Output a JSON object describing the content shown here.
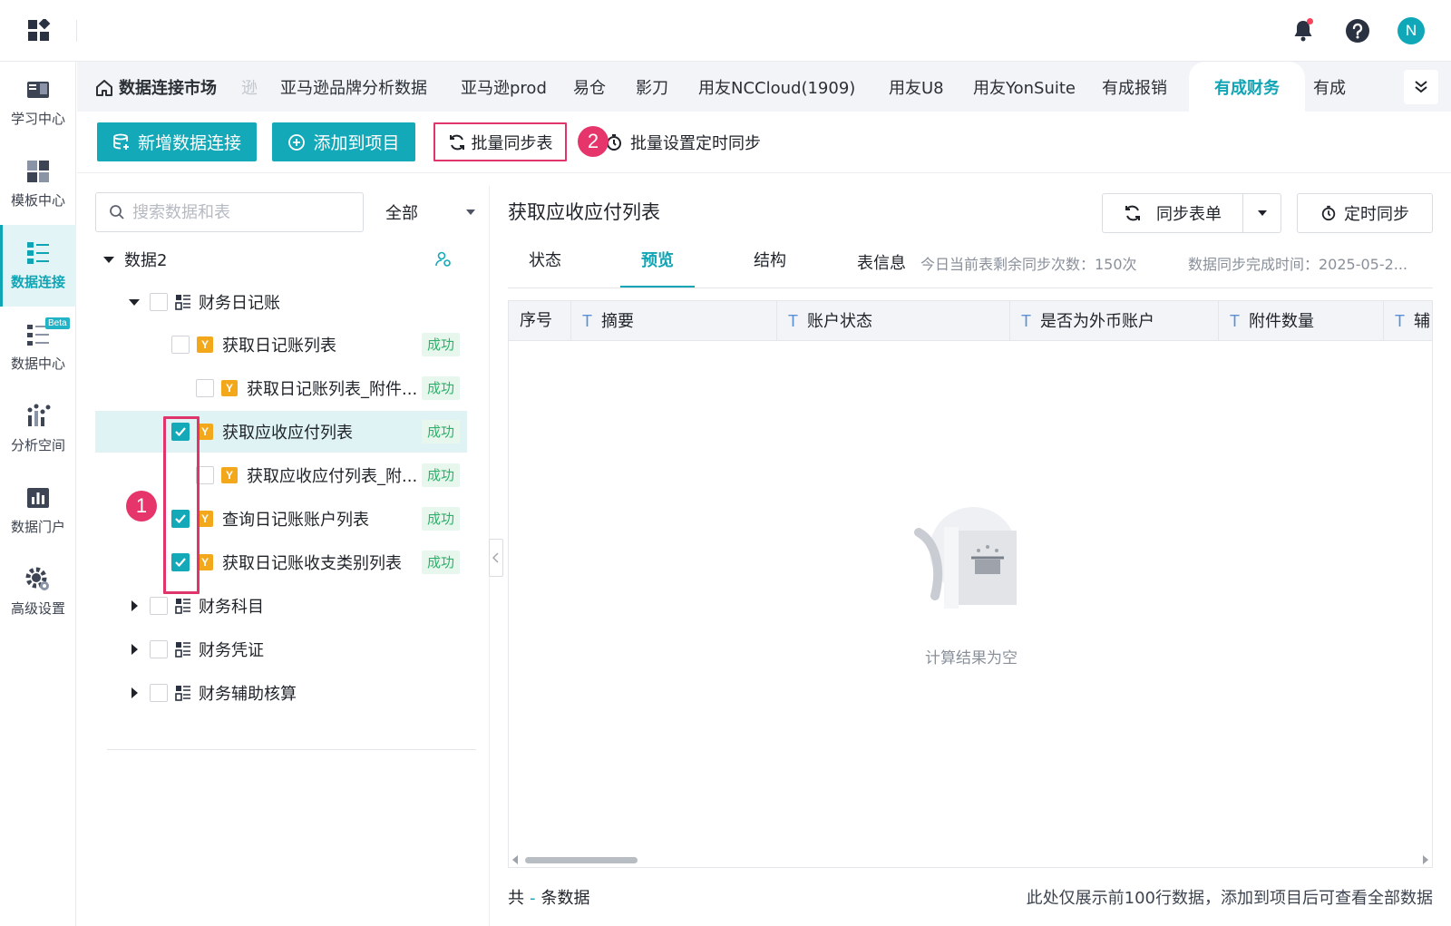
{
  "nav": {
    "items": [
      {
        "label": "学习中心",
        "icon": "study-center-icon"
      },
      {
        "label": "模板中心",
        "icon": "template-center-icon"
      },
      {
        "label": "数据连接",
        "icon": "data-connection-icon",
        "active": true
      },
      {
        "label": "数据中心",
        "icon": "data-center-icon",
        "badge": "Beta"
      },
      {
        "label": "分析空间",
        "icon": "analysis-space-icon"
      },
      {
        "label": "数据门户",
        "icon": "data-portal-icon"
      },
      {
        "label": "高级设置",
        "icon": "advanced-settings-icon"
      }
    ]
  },
  "header": {
    "avatar_initial": "N",
    "accent": "#13a9b8"
  },
  "tabs": {
    "home": "数据连接市场",
    "items": [
      "逊",
      "亚马逊品牌分析数据",
      "亚马逊prod",
      "易仓",
      "影刀",
      "用友NCCloud(1909)",
      "用友U8",
      "用友YonSuite",
      "有成报销",
      "有成财务",
      "有成"
    ],
    "active": "有成财务"
  },
  "toolbar": {
    "new_connection": "新增数据连接",
    "add_to_project": "添加到项目",
    "batch_sync": "批量同步表",
    "batch_schedule": "批量设置定时同步",
    "annotation_1": "1",
    "annotation_2": "2",
    "highlight_color": "#e0356a"
  },
  "tree": {
    "search_placeholder": "搜索数据和表",
    "filter_value": "全部",
    "root": "数据2",
    "nodes": [
      {
        "label": "财务日记账",
        "type": "folder",
        "expanded": true,
        "checked": false
      },
      {
        "label": "获取日记账列表",
        "type": "table",
        "checked": false,
        "status": "成功"
      },
      {
        "label": "获取日记账列表_附件...",
        "type": "table",
        "checked": false,
        "status": "成功"
      },
      {
        "label": "获取应收应付列表",
        "type": "table",
        "checked": true,
        "status": "成功",
        "selected": true
      },
      {
        "label": "获取应收应付列表_附...",
        "type": "table",
        "checked": false,
        "status": "成功"
      },
      {
        "label": "查询日记账账户列表",
        "type": "table",
        "checked": true,
        "status": "成功"
      },
      {
        "label": "获取日记账收支类别列表",
        "type": "table",
        "checked": true,
        "status": "成功"
      },
      {
        "label": "财务科目",
        "type": "folder",
        "expanded": false,
        "checked": false
      },
      {
        "label": "财务凭证",
        "type": "folder",
        "expanded": false,
        "checked": false
      },
      {
        "label": "财务辅助核算",
        "type": "folder",
        "expanded": false,
        "checked": false
      }
    ]
  },
  "detail": {
    "title": "获取应收应付列表",
    "sync_button": "同步表单",
    "schedule_button": "定时同步",
    "tabs": [
      "状态",
      "预览",
      "结构",
      "表信息"
    ],
    "active_tab": "预览",
    "remaining_sync": "今日当前表剩余同步次数：150次",
    "sync_time": "数据同步完成时间：2025-05-2...",
    "columns": [
      "序号",
      "摘要",
      "账户状态",
      "是否为外币账户",
      "附件数量",
      "辅"
    ],
    "empty_text": "计算结果为空",
    "footer_total_prefix": "共",
    "footer_total_value": "-",
    "footer_total_suffix": "条数据",
    "footer_note": "此处仅展示前100行数据，添加到项目后可查看全部数据"
  }
}
